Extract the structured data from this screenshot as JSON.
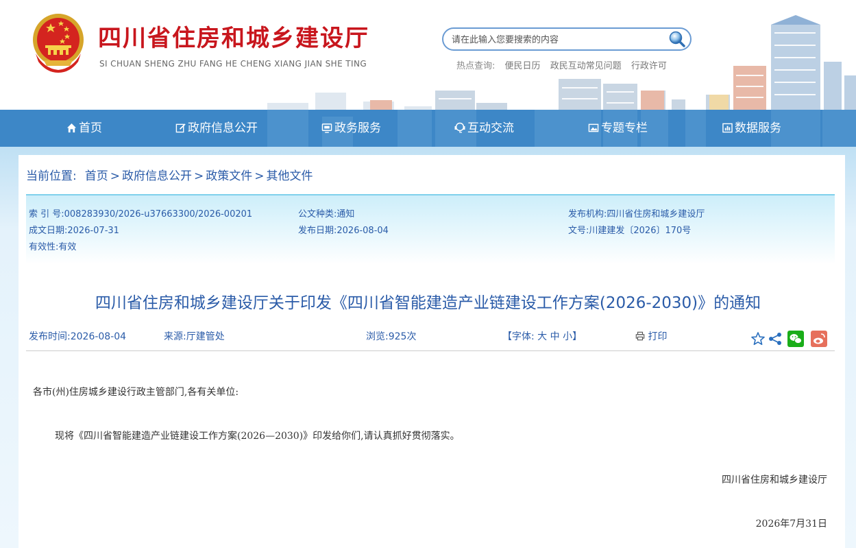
{
  "header": {
    "site_title": "四川省住房和城乡建设厅",
    "site_pinyin": "SI CHUAN SHENG ZHU FANG HE CHENG XIANG JIAN SHE TING",
    "search": {
      "placeholder": "请在此输入您要搜索的内容"
    },
    "hot_label": "热点查询:",
    "hot_links": [
      "便民日历",
      "政民互动常见问题",
      "行政许可"
    ]
  },
  "nav": [
    {
      "label": "首页",
      "icon": "home-icon"
    },
    {
      "label": "政府信息公开",
      "icon": "edit-icon"
    },
    {
      "label": "政务服务",
      "icon": "monitor-icon"
    },
    {
      "label": "互动交流",
      "icon": "interaction-icon"
    },
    {
      "label": "专题专栏",
      "icon": "image-icon"
    },
    {
      "label": "数据服务",
      "icon": "chart-icon"
    }
  ],
  "breadcrumb": {
    "label": "当前位置:",
    "items": [
      "首页",
      "政府信息公开",
      "政策文件",
      "其他文件"
    ],
    "separator": ">"
  },
  "meta": {
    "index_no": "索 引 号:008283930/2026-u37663300/2026-00201",
    "doc_type": "公文种类:通知",
    "publisher": "发布机构:四川省住房和城乡建设厅",
    "created_date": "成文日期:2026-07-31",
    "publish_date": "发布日期:2026-08-04",
    "doc_no": "文号:川建建发〔2026〕170号",
    "validity": "有效性:有效"
  },
  "article": {
    "title": "四川省住房和城乡建设厅关于印发《四川省智能建造产业链建设工作方案(2026-2030)》的通知",
    "publish_time": "发布时间:2026-08-04",
    "source": "来源:厅建管处",
    "views": "浏览:925次",
    "font_label": "【字体:",
    "font_large": "大",
    "font_medium": "中",
    "font_small": "小",
    "font_close": "】",
    "print_label": "打印",
    "salutation": "各市(州)住房城乡建设行政主管部门,各有关单位:",
    "paragraph": "现将《四川省智能建造产业链建设工作方案(2026—2030)》印发给你们,请认真抓好贯彻落实。",
    "signature": "四川省住房和城乡建设厅",
    "date": "2026年7月31日"
  },
  "share_icons": [
    "star-icon",
    "share-icon",
    "wechat-icon",
    "weibo-icon"
  ],
  "colors": {
    "brand_red": "#c8161d",
    "nav_blue": "#3d87c7",
    "link_blue": "#2a5ba8",
    "wechat_green": "#1aad19",
    "weibo_red": "#e6705c"
  }
}
